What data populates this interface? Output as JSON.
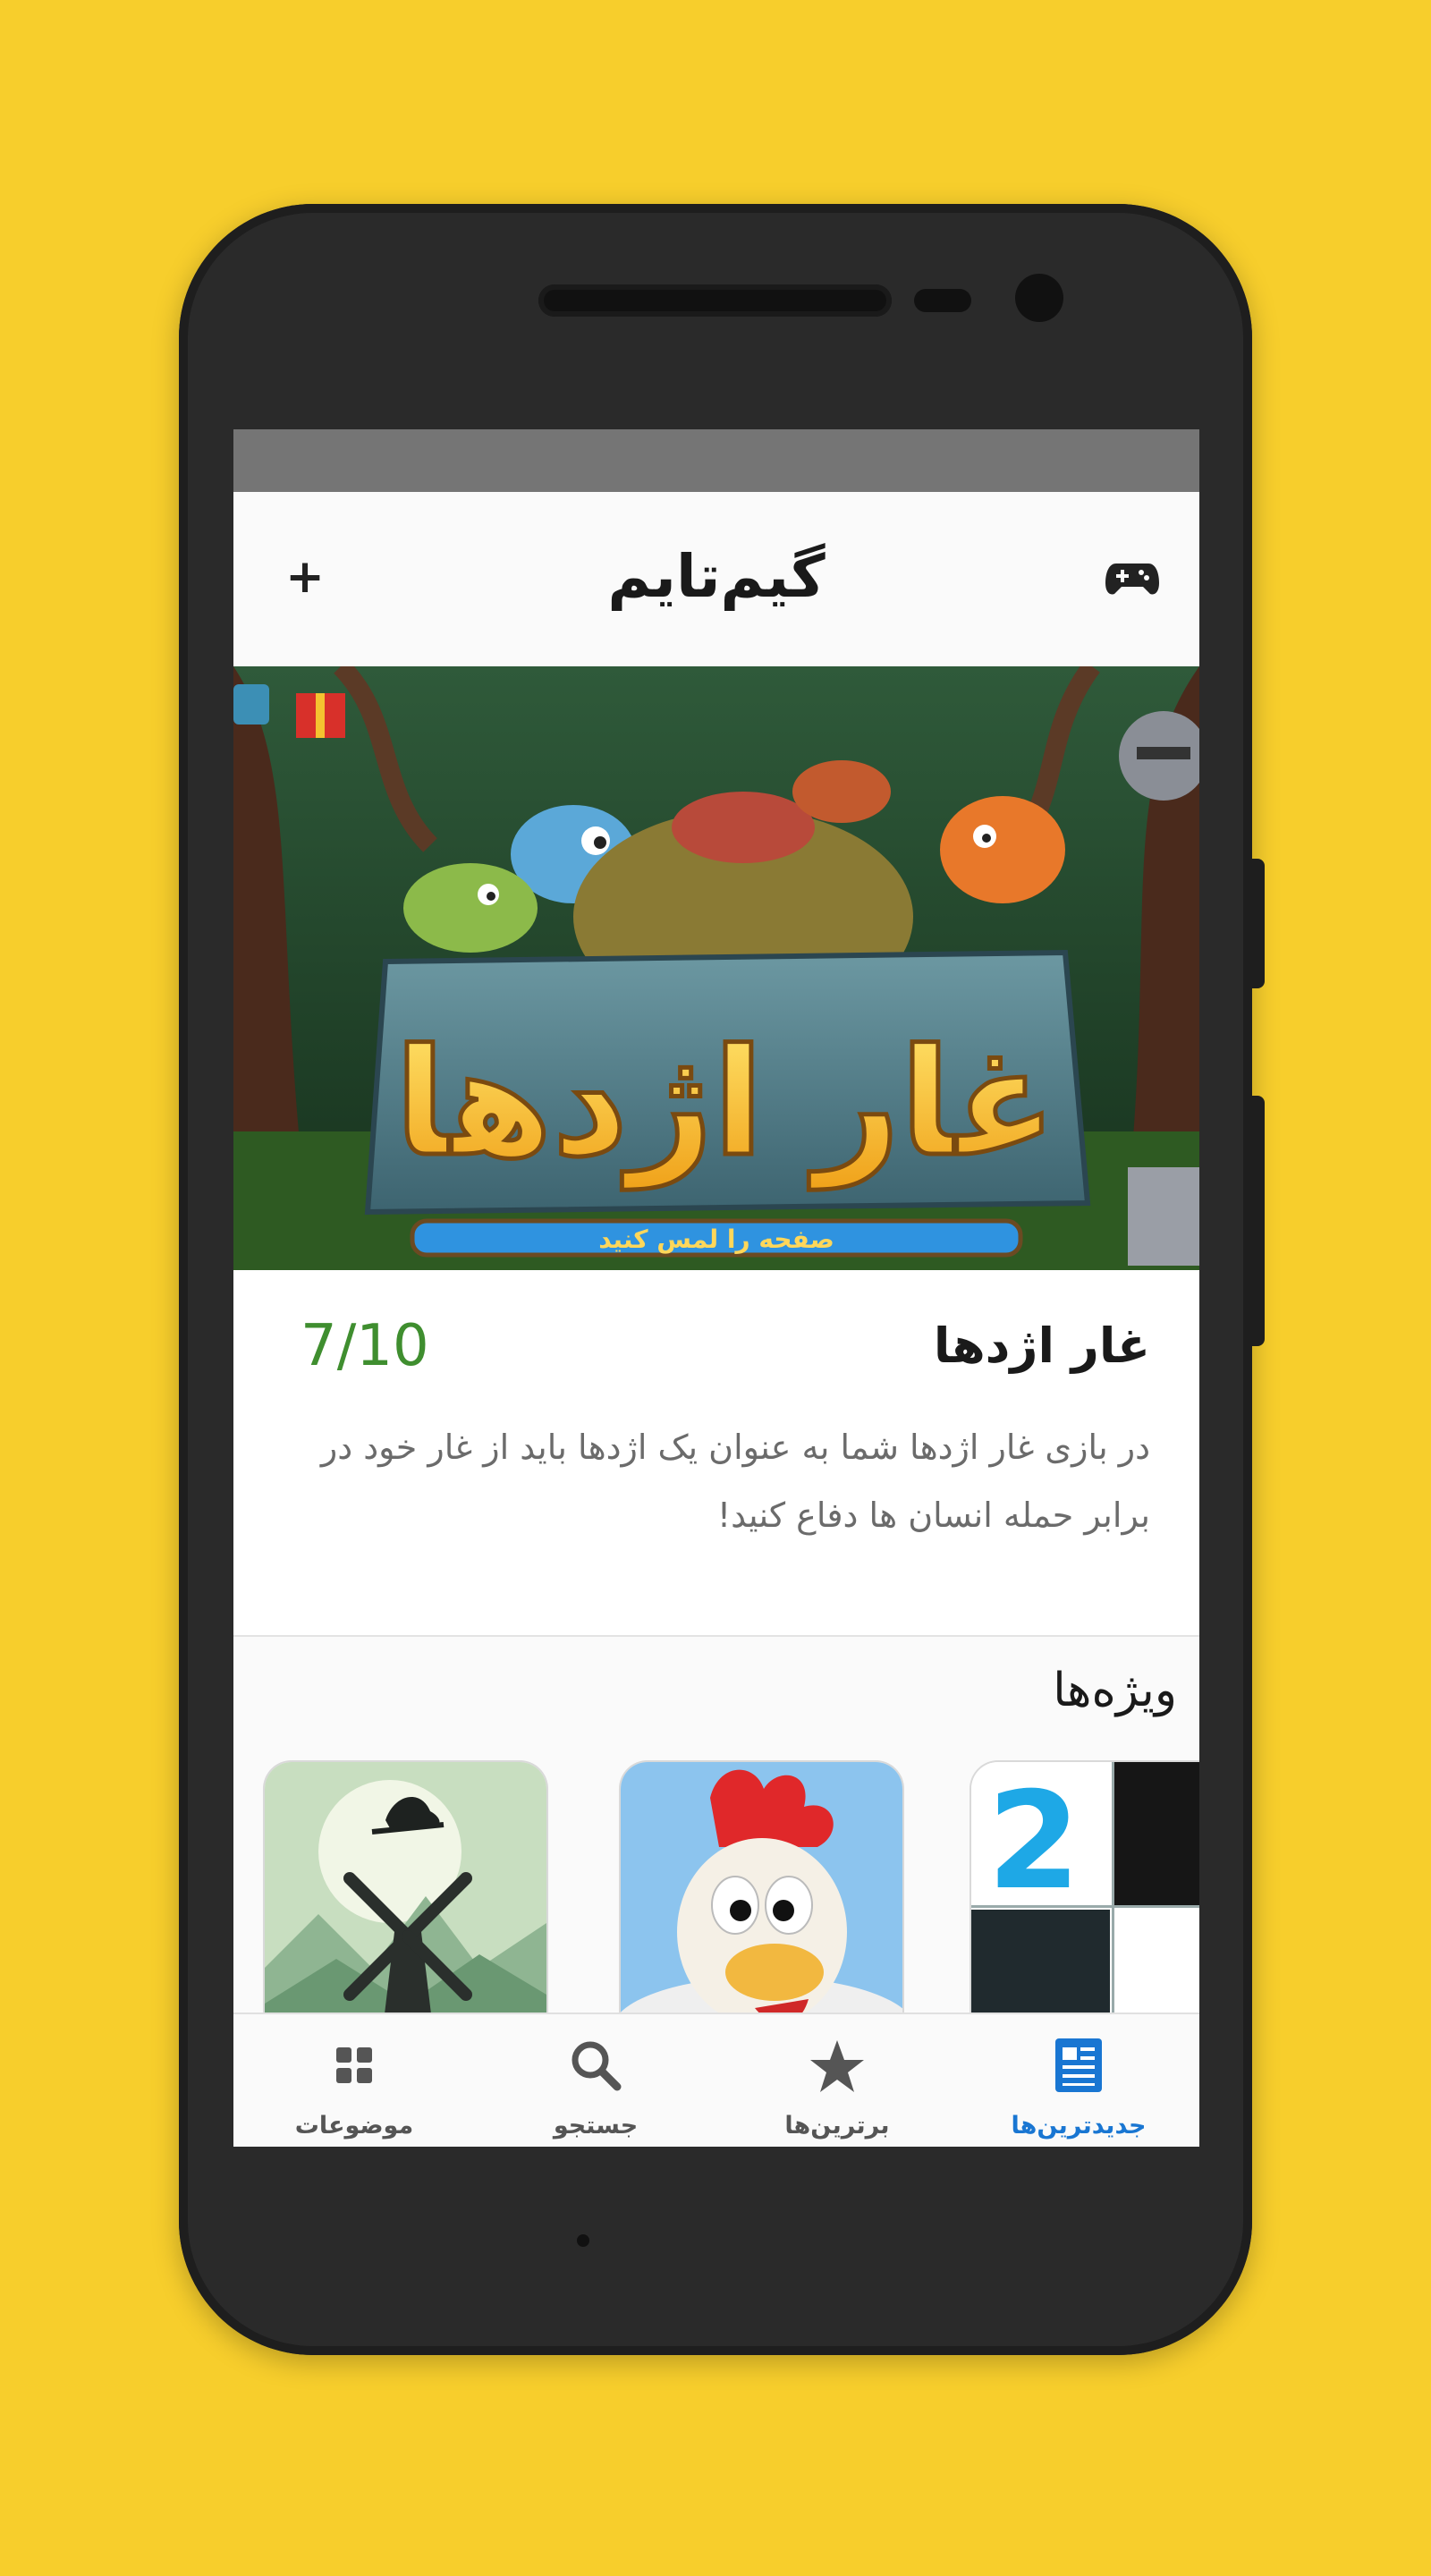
{
  "colors": {
    "background": "#F7CE2C",
    "phone_body": "#2A2A2A",
    "status_bar": "#757575",
    "rating_green": "#3F8E2F",
    "active_tab": "#1976D2",
    "inactive_tab": "#555555"
  },
  "app_bar": {
    "title": "گیم‌تایم",
    "left_icon": "plus-icon",
    "right_icon": "gamepad-icon"
  },
  "hero": {
    "game_logo_text": "غار اژدها",
    "banner_subtext": "صفحه را لمس کنید"
  },
  "game_card": {
    "name": "غار اژدها",
    "rating": "7/10",
    "description": "در بازی غار اژدها شما به عنوان یک اژدها باید از غار خود در برابر حمله انسان ها دفاع کنید!"
  },
  "featured": {
    "title": "ویژه‌ها",
    "tiles": [
      {
        "icon": "piano-tiles-2-icon"
      },
      {
        "icon": "chicken-game-icon"
      },
      {
        "icon": "windmill-silhouette-game-icon"
      }
    ]
  },
  "bottom_nav": {
    "items": [
      {
        "label": "جدیدترین‌ها",
        "icon": "newspaper-icon",
        "active": true
      },
      {
        "label": "برترین‌ها",
        "icon": "star-icon",
        "active": false
      },
      {
        "label": "جستجو",
        "icon": "search-icon",
        "active": false
      },
      {
        "label": "موضوعات",
        "icon": "grid-icon",
        "active": false
      }
    ]
  }
}
